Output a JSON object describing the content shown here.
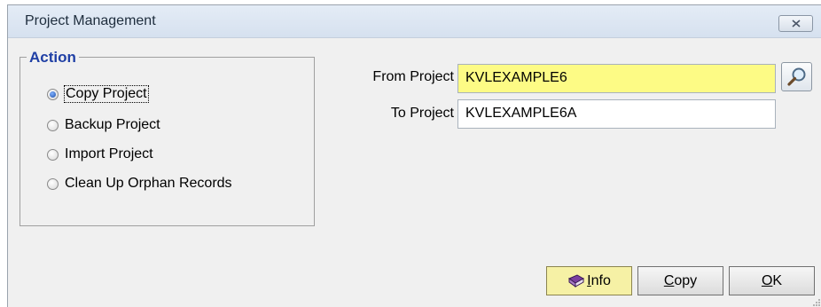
{
  "window": {
    "title": "Project Management"
  },
  "action_group": {
    "legend": "Action",
    "options": [
      {
        "label": "Copy Project",
        "selected": true
      },
      {
        "label": "Backup Project",
        "selected": false
      },
      {
        "label": "Import Project",
        "selected": false
      },
      {
        "label": "Clean Up Orphan Records",
        "selected": false
      }
    ]
  },
  "fields": {
    "from_label": "From Project",
    "from_value": "KVLEXAMPLE6",
    "to_label": "To Project",
    "to_value": "KVLEXAMPLE6A"
  },
  "buttons": {
    "info_accel": "I",
    "info_rest": "nfo",
    "copy_accel": "C",
    "copy_rest": "opy",
    "ok_accel": "O",
    "ok_rest": "K"
  },
  "icons": {
    "close": "close-icon",
    "lookup": "magnifier-icon",
    "info": "book-icon"
  },
  "colors": {
    "highlight_field": "#fdfb85",
    "legend": "#1f3fa5",
    "info_button": "#f6f1a5"
  }
}
